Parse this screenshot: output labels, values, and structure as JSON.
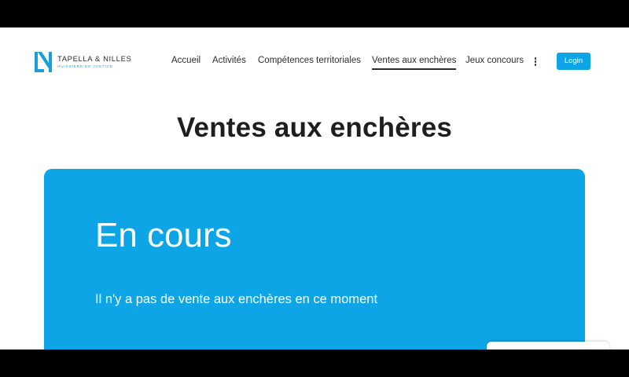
{
  "brand": {
    "name": "TAPELLA & NILLES",
    "tagline": "HUISSIERS DE JUSTICE",
    "color": "#1a9fd9"
  },
  "nav": {
    "items": [
      {
        "label": "Accueil",
        "active": false
      },
      {
        "label": "Activités",
        "active": false
      },
      {
        "label": "Compétences territoriales",
        "active": false
      },
      {
        "label": "Ventes aux enchères",
        "active": true
      },
      {
        "label": "Jeux concours",
        "active": false
      }
    ],
    "more_icon": "vertical-dots-icon"
  },
  "login": {
    "label": "Login"
  },
  "page": {
    "title": "Ventes aux enchères"
  },
  "panel": {
    "heading": "En cours",
    "message": "Il n'y a pas de vente aux enchères en ce moment",
    "color": "#0ea5e6"
  }
}
